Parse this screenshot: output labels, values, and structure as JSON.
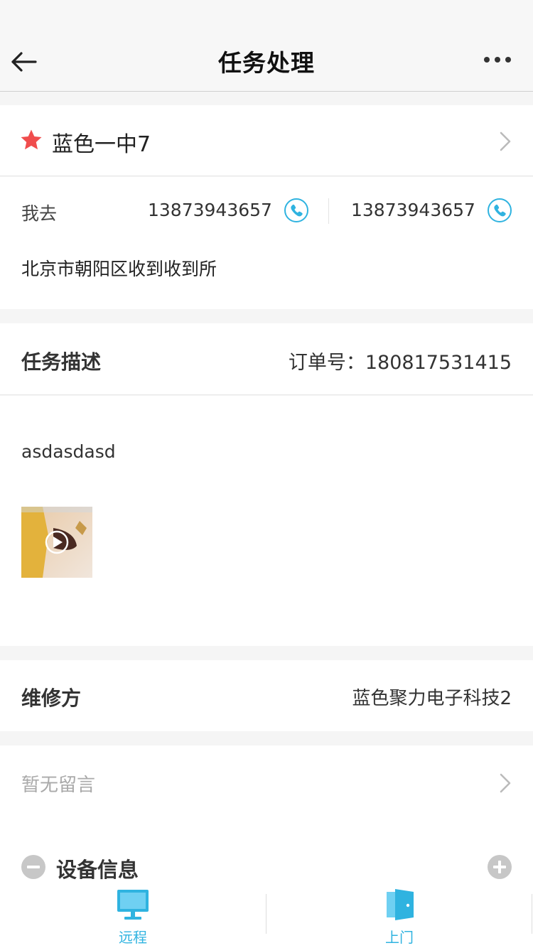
{
  "header": {
    "title": "任务处理",
    "back_icon": "back-arrow-icon",
    "more_icon": "more-icon"
  },
  "customer": {
    "name": "蓝色一中7",
    "star_color": "#f04d4d"
  },
  "contact": {
    "name": "我去",
    "phone1": "13873943657",
    "phone2": "13873943657",
    "address": "北京市朝阳区收到收到所",
    "phone_icon_color": "#2fb3e0"
  },
  "task": {
    "description_label": "任务描述",
    "order_label": "订单号：",
    "order_number": "180817531415",
    "description_text": "asdasdasd"
  },
  "repair": {
    "label": "维修方",
    "value": "蓝色聚力电子科技2"
  },
  "messages": {
    "empty_text": "暂无留言"
  },
  "device": {
    "label": "设备信息"
  },
  "tabbar": {
    "remote_label": "远程",
    "onsite_label": "上门",
    "accent": "#2fb3e0"
  }
}
